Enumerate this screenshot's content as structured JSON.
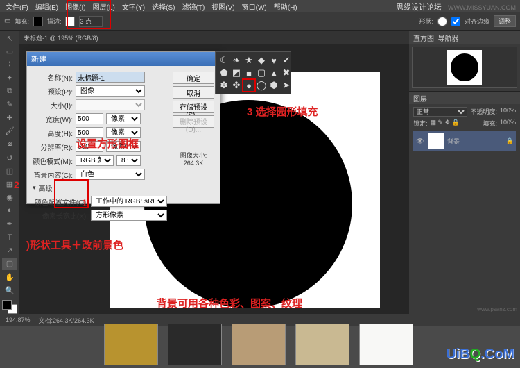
{
  "site": {
    "name": "思缘设计论坛",
    "url": "WWW.MISSYUAN.COM"
  },
  "menubar": [
    "文件(F)",
    "编辑(E)",
    "图像(I)",
    "图层(L)",
    "文字(Y)",
    "选择(S)",
    "滤镜(T)",
    "视图(V)",
    "窗口(W)",
    "帮助(H)"
  ],
  "optbar": {
    "fill_label": "填充:",
    "stroke_label": "描边:",
    "stroke_width": "3 点",
    "shape_label": "形状:",
    "align_label": "对齐边缘",
    "btn": "调整"
  },
  "tab": {
    "name": "未标题-1 @ 195% (RGB/8)"
  },
  "dialog": {
    "title": "新建",
    "name_label": "名称(N):",
    "name_value": "未标题-1",
    "preset_label": "预设(P):",
    "preset_value": "图像",
    "size_label": "大小(I):",
    "width_label": "宽度(W):",
    "width_value": "500",
    "width_unit": "像素",
    "height_label": "高度(H):",
    "height_value": "500",
    "height_unit": "像素",
    "res_label": "分辨率(R):",
    "res_value": "600",
    "res_unit": "像素/英寸",
    "mode_label": "颜色模式(M):",
    "mode_value": "RGB 颜色",
    "mode_bits": "8 位",
    "bg_label": "背景内容(C):",
    "bg_value": "白色",
    "advanced": "高级",
    "profile_label": "颜色配置文件(O):",
    "profile_value": "工作中的 RGB: sRGB IEC6196...",
    "aspect_label": "像素长宽比(X):",
    "aspect_value": "方形像素",
    "filesize_label": "图像大小:",
    "filesize_value": "264.3K",
    "btn_ok": "确定",
    "btn_cancel": "取消",
    "btn_save": "存储预设(S)...",
    "btn_del": "删除预设(D)..."
  },
  "panels": {
    "nav_tab1": "直方图",
    "nav_tab2": "导航器",
    "layers_tab": "图层",
    "blend": "正常",
    "opacity_label": "不透明度:",
    "opacity": "100%",
    "lock_label": "锁定:",
    "fill_label": "填充:",
    "fill": "100%",
    "layer_name": "背景"
  },
  "status": {
    "zoom": "194.87%",
    "doc": "文档:264.3K/264.3K"
  },
  "annotations": {
    "a1": "1",
    "a2_label": "2",
    "a2": "设置方形图框",
    "a3": "3 选择园形填充",
    "a4": ")形状工具＋改前景色",
    "a5": "背景可用各种色彩、图案、纹理"
  },
  "watermarks": {
    "mid": "www.psanz.com",
    "bottom": "UiBQ.CoM"
  },
  "swatch_colors": [
    "#b8932f",
    "#2a2a2a",
    "#b89c76",
    "#c9b992",
    "#f8f8f6"
  ]
}
